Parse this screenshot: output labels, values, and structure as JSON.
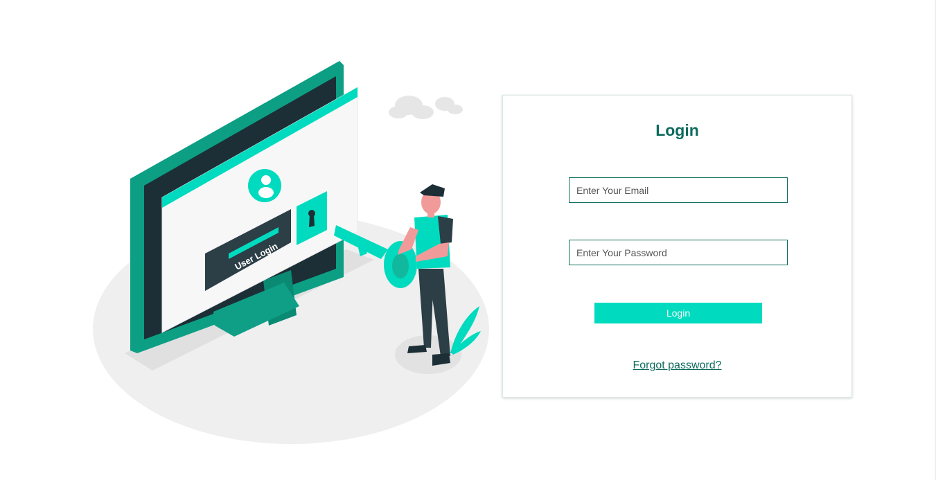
{
  "illustration": {
    "screen_label": "User Login"
  },
  "login": {
    "title": "Login",
    "email_placeholder": "Enter Your Email",
    "password_placeholder": "Enter Your Password",
    "button_label": "Login",
    "forgot_label": "Forgot password?"
  },
  "colors": {
    "brand_dark": "#0d6b5c",
    "accent": "#00dbbf"
  }
}
